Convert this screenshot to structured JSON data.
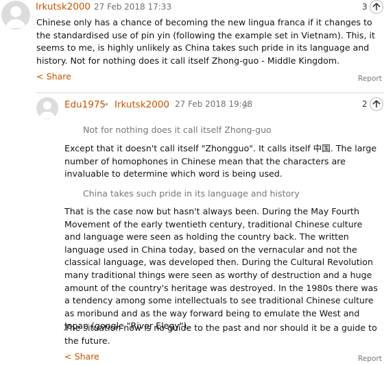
{
  "comment1": {
    "author": "Irkutsk2000",
    "timestamp": "27 Feb 2018 17:33",
    "recommend_count": "3",
    "body": "Chinese only has a chance of becoming the new lingua franca if it changes to the standardised use of pin yin (following the example set in Vietnam). This, it seems to me, is highly unlikely as China takes such pride in its language and history. Not for nothing does it call itself Zhong-guo - Middle Kingdom.",
    "share_label": "Share",
    "report_label": "Report"
  },
  "comment2": {
    "author": "Edu1975",
    "reply_arrow": "→",
    "reply_to": "Irkutsk2000",
    "timestamp": "27 Feb 2018 19:48",
    "recommend_count": "2",
    "quote1": "Not for nothing does it call itself Zhong-guo",
    "para1": "Except that it doesn't call itself \"Zhongguo\". It calls itself 中国. The large number of homophones in Chinese mean that the characters are invaluable to determine which word is being used.",
    "quote2": "China takes such pride in its language and history",
    "para2": "That is the case now but hasn't always been. During the May Fourth Movement of the early twentieth century, traditional Chinese culture and language were seen as holding the country back. The written language used in China today, based on the vernacular and not the classical language, was developed then. During the Cultural Revolution many traditional things were seen as worthy of destruction and a huge amount of the country's heritage was destroyed. In the 1980s there was a tendency among some intellectuals to see traditional Chinese culture as moribund and as the way forward being to emulate the West and Japan (google \"River Elegy\").",
    "para3": "The situation now is no guide to the past and nor should it be a guide to the future.",
    "share_label": "Share",
    "report_label": "Report"
  },
  "colors": {
    "accent": "#c05303",
    "muted": "#767676",
    "divider": "#dcdcdc"
  }
}
